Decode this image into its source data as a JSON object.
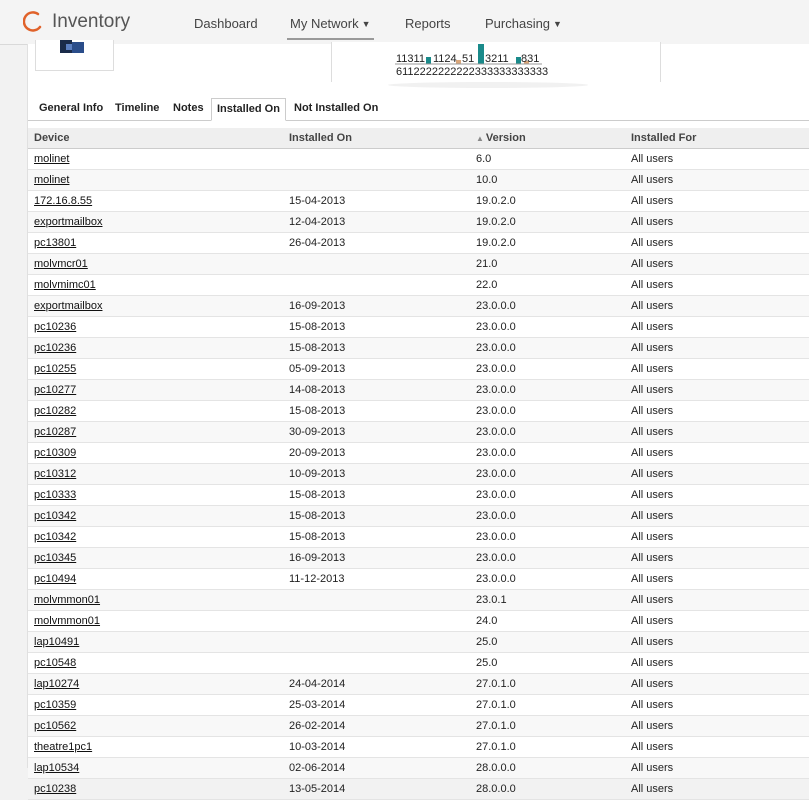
{
  "app": {
    "title": "Inventory"
  },
  "nav": {
    "items": [
      {
        "label": "Dashboard"
      },
      {
        "label": "My Network"
      },
      {
        "label": "Reports"
      },
      {
        "label": "Purchasing"
      }
    ]
  },
  "chart": {
    "top_digits": "11311",
    "top_digits_b": "1124",
    "top_digits_c": "51",
    "top_digits_d": "3211",
    "top_digits_e": "831",
    "bottom_digits": "6112222222222333333333333"
  },
  "tabs": [
    {
      "label": "General Info"
    },
    {
      "label": "Timeline"
    },
    {
      "label": "Notes"
    },
    {
      "label": "Installed On"
    },
    {
      "label": "Not Installed On"
    }
  ],
  "table": {
    "columns": [
      "Device",
      "Installed On",
      "Version",
      "Installed For"
    ],
    "sort_column": "Version",
    "rows": [
      [
        "molinet",
        "",
        "6.0",
        "All users"
      ],
      [
        "molinet",
        "",
        "10.0",
        "All users"
      ],
      [
        "172.16.8.55",
        "15-04-2013",
        "19.0.2.0",
        "All users"
      ],
      [
        "exportmailbox",
        "12-04-2013",
        "19.0.2.0",
        "All users"
      ],
      [
        "pc13801",
        "26-04-2013",
        "19.0.2.0",
        "All users"
      ],
      [
        "molvmcr01",
        "",
        "21.0",
        "All users"
      ],
      [
        "molvmimc01",
        "",
        "22.0",
        "All users"
      ],
      [
        "exportmailbox",
        "16-09-2013",
        "23.0.0.0",
        "All users"
      ],
      [
        "pc10236",
        "15-08-2013",
        "23.0.0.0",
        "All users"
      ],
      [
        "pc10236",
        "15-08-2013",
        "23.0.0.0",
        "All users"
      ],
      [
        "pc10255",
        "05-09-2013",
        "23.0.0.0",
        "All users"
      ],
      [
        "pc10277",
        "14-08-2013",
        "23.0.0.0",
        "All users"
      ],
      [
        "pc10282",
        "15-08-2013",
        "23.0.0.0",
        "All users"
      ],
      [
        "pc10287",
        "30-09-2013",
        "23.0.0.0",
        "All users"
      ],
      [
        "pc10309",
        "20-09-2013",
        "23.0.0.0",
        "All users"
      ],
      [
        "pc10312",
        "10-09-2013",
        "23.0.0.0",
        "All users"
      ],
      [
        "pc10333",
        "15-08-2013",
        "23.0.0.0",
        "All users"
      ],
      [
        "pc10342",
        "15-08-2013",
        "23.0.0.0",
        "All users"
      ],
      [
        "pc10342",
        "15-08-2013",
        "23.0.0.0",
        "All users"
      ],
      [
        "pc10345",
        "16-09-2013",
        "23.0.0.0",
        "All users"
      ],
      [
        "pc10494",
        "11-12-2013",
        "23.0.0.0",
        "All users"
      ],
      [
        "molvmmon01",
        "",
        "23.0.1",
        "All users"
      ],
      [
        "molvmmon01",
        "",
        "24.0",
        "All users"
      ],
      [
        "lap10491",
        "",
        "25.0",
        "All users"
      ],
      [
        "pc10548",
        "",
        "25.0",
        "All users"
      ],
      [
        "lap10274",
        "24-04-2014",
        "27.0.1.0",
        "All users"
      ],
      [
        "pc10359",
        "25-03-2014",
        "27.0.1.0",
        "All users"
      ],
      [
        "pc10562",
        "26-02-2014",
        "27.0.1.0",
        "All users"
      ],
      [
        "theatre1pc1",
        "10-03-2014",
        "27.0.1.0",
        "All users"
      ],
      [
        "lap10534",
        "02-06-2014",
        "28.0.0.0",
        "All users"
      ],
      [
        "pc10238",
        "13-05-2014",
        "28.0.0.0",
        "All users"
      ]
    ]
  },
  "colors": {
    "accent": "#e0622a",
    "bar_teal": "#1a8a8a",
    "bar_tan": "#d9a67a"
  }
}
